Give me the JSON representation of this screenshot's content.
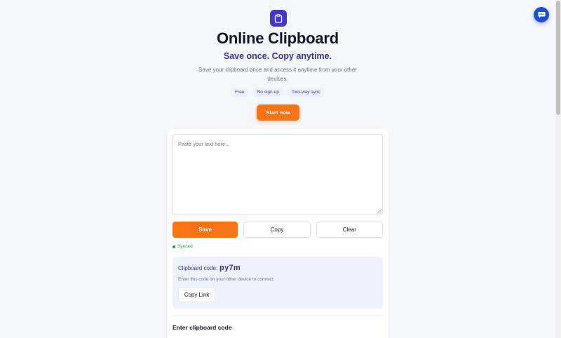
{
  "hero": {
    "logo_icon": "clipboard-icon",
    "title": "Online Clipboard",
    "tagline": "Save once. Copy anytime.",
    "description": "Save your clipboard once and access it anytime from your other devices.",
    "chips": [
      "Free",
      "No sign-up",
      "Two-way sync"
    ],
    "start_label": "Start now"
  },
  "editor": {
    "placeholder": "Paste your text here...",
    "value": ""
  },
  "actions": {
    "save_label": "Save",
    "copy_label": "Copy",
    "clear_label": "Clear"
  },
  "status": {
    "text": "Synced",
    "color": "#16a34a"
  },
  "code_panel": {
    "label": "Clipboard code:",
    "code": "py7m",
    "hint": "Enter this code on your other device to connect.",
    "copy_link_label": "Copy Link"
  },
  "enter_code": {
    "title": "Enter clipboard code"
  },
  "chat": {
    "icon": "chat-bubble-icon"
  },
  "colors": {
    "accent": "#f97316",
    "brand": "#3730a3",
    "chat": "#1d4ed8"
  }
}
